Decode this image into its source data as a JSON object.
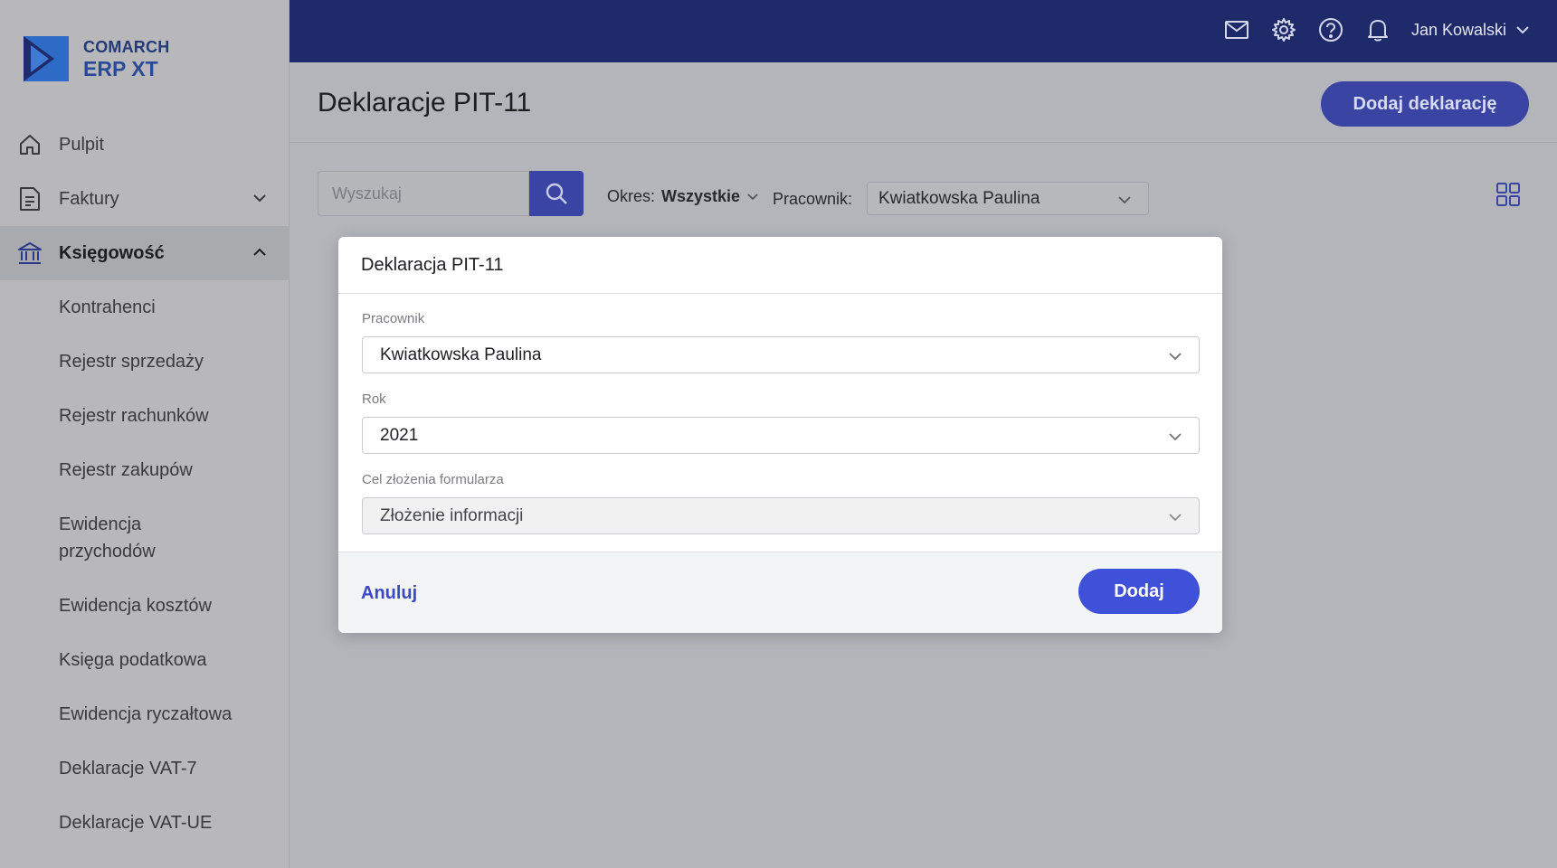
{
  "brand": {
    "line1": "COMARCH",
    "line2": "ERP XT",
    "colors": {
      "dark": "#1e2a6a",
      "accent": "#3f50d9",
      "logo_blue": "#2e6bc6"
    }
  },
  "topbar": {
    "user_name": "Jan Kowalski",
    "icons": [
      "mail-icon",
      "gear-icon",
      "help-icon",
      "bell-icon",
      "chevron-down-icon"
    ]
  },
  "sidebar": {
    "items": [
      {
        "label": "Pulpit",
        "icon": "home-icon"
      },
      {
        "label": "Faktury",
        "icon": "document-icon",
        "expandable": true
      },
      {
        "label": "Księgowość",
        "icon": "bank-icon",
        "expanded": true
      }
    ],
    "subitems": [
      "Kontrahenci",
      "Rejestr sprzedaży",
      "Rejestr rachunków",
      "Rejestr zakupów",
      "Ewidencja przychodów",
      "Ewidencja kosztów",
      "Księga podatkowa",
      "Ewidencja ryczałtowa",
      "Deklaracje VAT-7",
      "Deklaracje VAT-UE"
    ]
  },
  "page": {
    "title": "Deklaracje PIT-11",
    "add_button": "Dodaj deklarację"
  },
  "filters": {
    "search_placeholder": "Wyszukaj",
    "period_label": "Okres:",
    "period_value": "Wszystkie",
    "employee_label": "Pracownik:",
    "employee_value": "Kwiatkowska Paulina"
  },
  "modal": {
    "title": "Deklaracja PIT-11",
    "fields": [
      {
        "label": "Pracownik",
        "value": "Kwiatkowska Paulina"
      },
      {
        "label": "Rok",
        "value": "2021"
      },
      {
        "label": "Cel złożenia formularza",
        "value": "Złożenie informacji",
        "disabled": true
      }
    ],
    "cancel": "Anuluj",
    "submit": "Dodaj"
  }
}
